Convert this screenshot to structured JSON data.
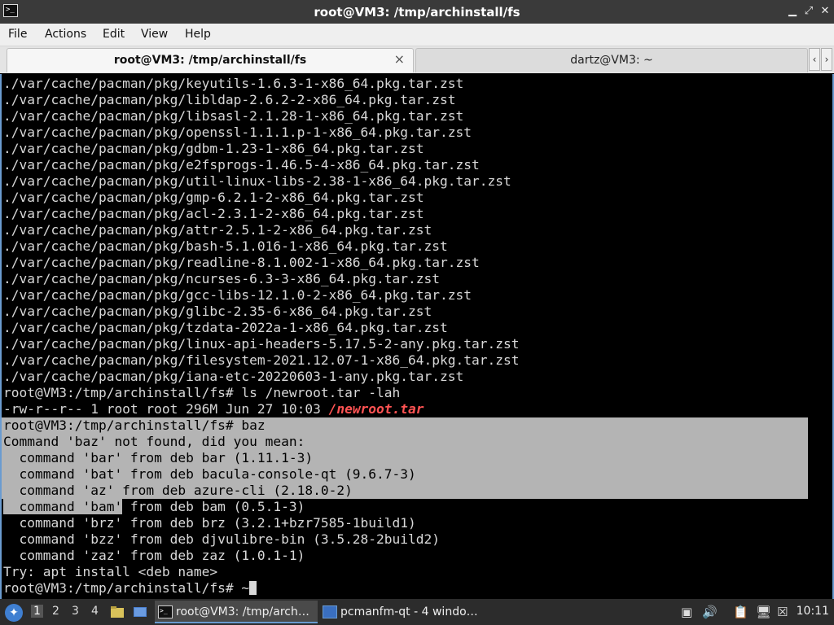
{
  "window": {
    "title": "root@VM3: /tmp/archinstall/fs",
    "app_icon": "terminal-icon",
    "controls": [
      "minimize-icon",
      "maximize-icon",
      "close-icon"
    ]
  },
  "menu": {
    "file": "File",
    "actions": "Actions",
    "edit": "Edit",
    "view": "View",
    "help": "Help"
  },
  "tabs": {
    "active": {
      "label": "root@VM3: /tmp/archinstall/fs",
      "close": "×"
    },
    "inactive": {
      "label": "dartz@VM3: ~"
    },
    "scroll_left": "‹",
    "scroll_right": "›"
  },
  "terminal": {
    "lines": [
      "./var/cache/pacman/pkg/keyutils-1.6.3-1-x86_64.pkg.tar.zst",
      "./var/cache/pacman/pkg/libldap-2.6.2-2-x86_64.pkg.tar.zst",
      "./var/cache/pacman/pkg/libsasl-2.1.28-1-x86_64.pkg.tar.zst",
      "./var/cache/pacman/pkg/openssl-1.1.1.p-1-x86_64.pkg.tar.zst",
      "./var/cache/pacman/pkg/gdbm-1.23-1-x86_64.pkg.tar.zst",
      "./var/cache/pacman/pkg/e2fsprogs-1.46.5-4-x86_64.pkg.tar.zst",
      "./var/cache/pacman/pkg/util-linux-libs-2.38-1-x86_64.pkg.tar.zst",
      "./var/cache/pacman/pkg/gmp-6.2.1-2-x86_64.pkg.tar.zst",
      "./var/cache/pacman/pkg/acl-2.3.1-2-x86_64.pkg.tar.zst",
      "./var/cache/pacman/pkg/attr-2.5.1-2-x86_64.pkg.tar.zst",
      "./var/cache/pacman/pkg/bash-5.1.016-1-x86_64.pkg.tar.zst",
      "./var/cache/pacman/pkg/readline-8.1.002-1-x86_64.pkg.tar.zst",
      "./var/cache/pacman/pkg/ncurses-6.3-3-x86_64.pkg.tar.zst",
      "./var/cache/pacman/pkg/gcc-libs-12.1.0-2-x86_64.pkg.tar.zst",
      "./var/cache/pacman/pkg/glibc-2.35-6-x86_64.pkg.tar.zst",
      "./var/cache/pacman/pkg/tzdata-2022a-1-x86_64.pkg.tar.zst",
      "./var/cache/pacman/pkg/linux-api-headers-5.17.5-2-any.pkg.tar.zst",
      "./var/cache/pacman/pkg/filesystem-2021.12.07-1-x86_64.pkg.tar.zst",
      "./var/cache/pacman/pkg/iana-etc-20220603-1-any.pkg.tar.zst",
      "root@VM3:/tmp/archinstall/fs# ls /newroot.tar -lah"
    ],
    "ls_output_prefix": "-rw-r--r-- 1 root root 296M Jun 27 10:03 ",
    "ls_output_file": "/newroot.tar",
    "selected_lines": [
      "root@VM3:/tmp/archinstall/fs# baz",
      "Command 'baz' not found, did you mean:",
      "  command 'bar' from deb bar (1.11.1-3)",
      "  command 'bat' from deb bacula-console-qt (9.6.7-3)",
      "  command 'az' from deb azure-cli (2.18.0-2)"
    ],
    "partial_selected": "  command 'bam'",
    "partial_rest": " from deb bam (0.5.1-3)",
    "after_lines": [
      "  command 'brz' from deb brz (3.2.1+bzr7585-1build1)",
      "  command 'bzz' from deb djvulibre-bin (3.5.28-2build2)",
      "  command 'zaz' from deb zaz (1.0.1-1)",
      "Try: apt install <deb name>"
    ],
    "prompt": "root@VM3:/tmp/archinstall/fs# ~",
    "colors": {
      "background": "#000000",
      "text": "#d8d8d8",
      "selection": "#b4b4b4",
      "file_highlight": "#ff5353"
    }
  },
  "taskbar": {
    "start_icon": "lxqt-start-icon",
    "workspaces": [
      "1",
      "2",
      "3",
      "4"
    ],
    "tasks": [
      {
        "label": "root@VM3: /tmp/arch…",
        "icon": "terminal-icon"
      },
      {
        "label": "pcmanfm-qt - 4 windo…",
        "icon": "folder-icon"
      }
    ],
    "tray_icons": [
      "volume-icon",
      "clipboard-icon",
      "network-icon",
      "notification-icon"
    ],
    "clock": "10:11"
  }
}
